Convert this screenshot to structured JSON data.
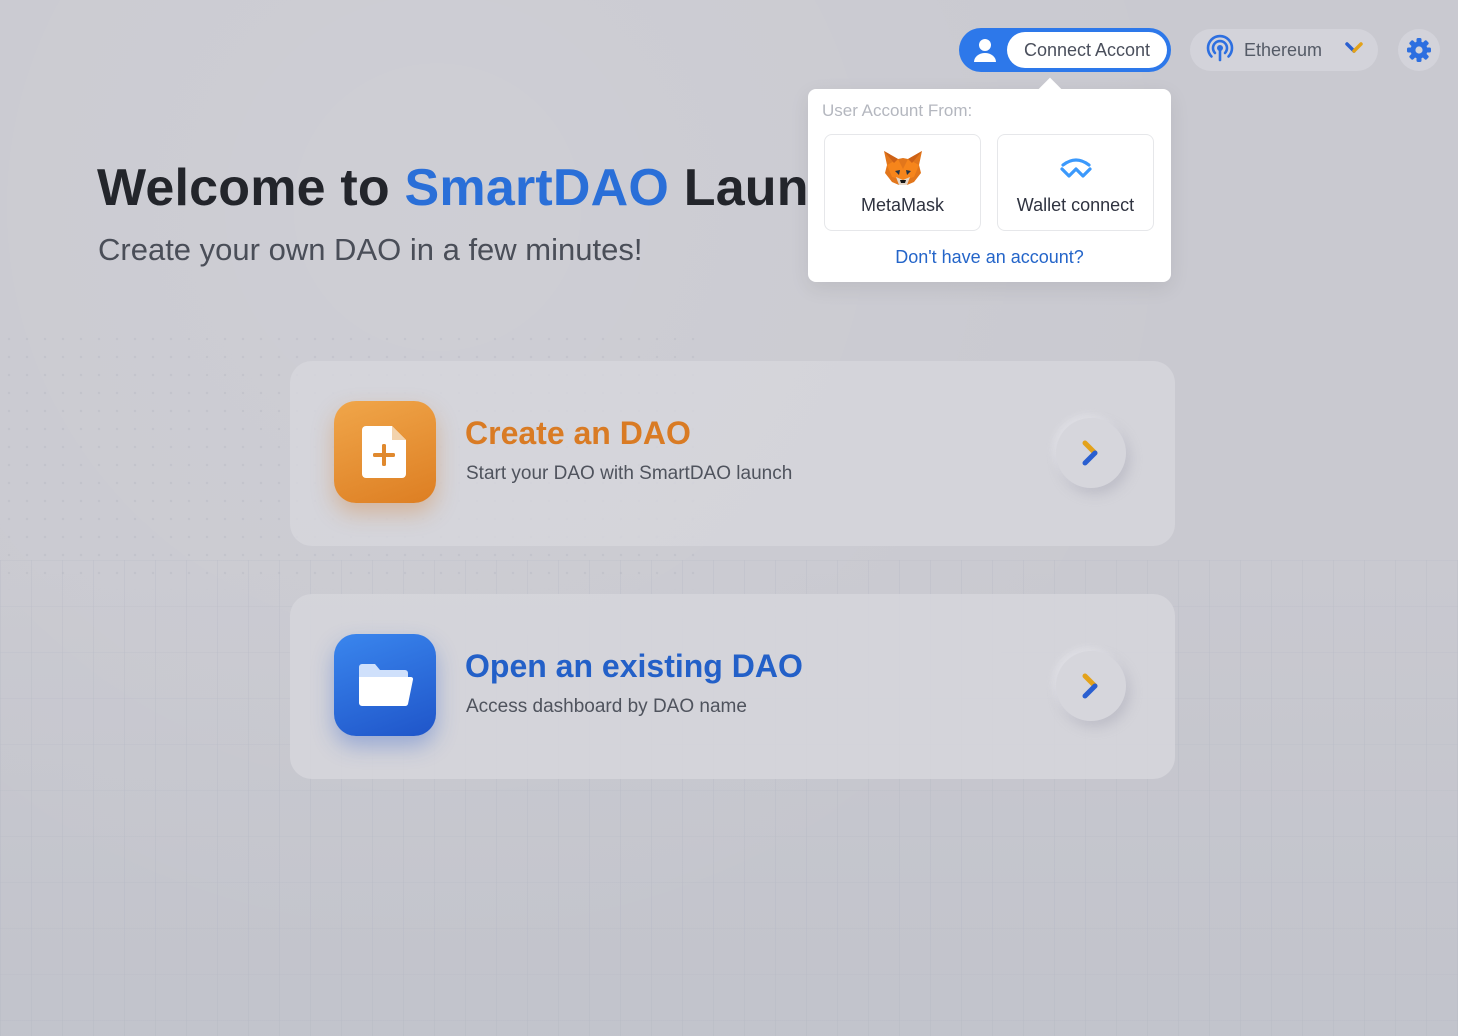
{
  "topbar": {
    "connect_label": "Connect Accont",
    "network_label": "Ethereum",
    "user_icon": "user-icon",
    "network_icon": "broadcast-icon",
    "settings_icon": "gear-icon"
  },
  "popover": {
    "heading": "User Account From:",
    "options": [
      {
        "label": "MetaMask",
        "icon": "metamask-fox-icon"
      },
      {
        "label": "Wallet connect",
        "icon": "walletconnect-icon"
      }
    ],
    "no_account_link": "Don't have an account?"
  },
  "hero": {
    "title_prefix": "Welcome to ",
    "title_brand": "SmartDAO",
    "title_suffix": " Launch",
    "subtitle": "Create your own DAO in a few minutes!"
  },
  "cards": [
    {
      "title": "Create an DAO",
      "description": "Start your DAO with SmartDAO launch",
      "icon": "add-file-icon"
    },
    {
      "title": "Open an existing DAO",
      "description": "Access dashboard by DAO name",
      "icon": "folder-icon"
    }
  ],
  "colors": {
    "accent": "#2d78ea",
    "brand": "#2a6fd8",
    "create_orange": "#d97b24",
    "open_blue": "#2360c8"
  }
}
